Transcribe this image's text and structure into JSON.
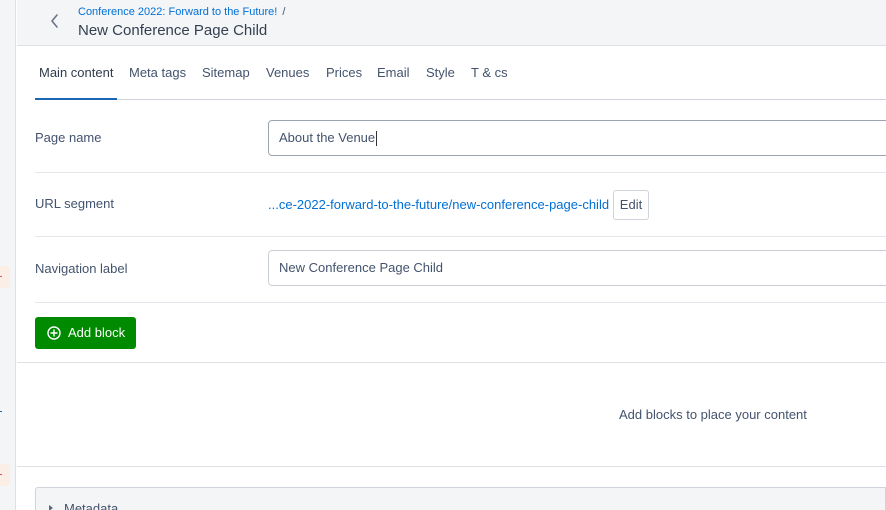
{
  "header": {
    "breadcrumb": "Conference 2022: Forward to the Future!",
    "separator": "/",
    "title": "New Conference Page Child",
    "back_icon": "chevron-left-icon"
  },
  "tabs": [
    {
      "label": "Main content",
      "active": true
    },
    {
      "label": "Meta tags",
      "active": false
    },
    {
      "label": "Sitemap",
      "active": false
    },
    {
      "label": "Venues",
      "active": false
    },
    {
      "label": "Prices",
      "active": false
    },
    {
      "label": "Email",
      "active": false
    },
    {
      "label": "Style",
      "active": false
    },
    {
      "label": "T & cs",
      "active": false
    }
  ],
  "fields": {
    "page_name": {
      "label": "Page name",
      "value": "About the Venue"
    },
    "url_segment": {
      "label": "URL segment",
      "value": "...ce-2022-forward-to-the-future/new-conference-page-child",
      "edit_label": "Edit"
    },
    "navigation_label": {
      "label": "Navigation label",
      "value": "New Conference Page Child"
    }
  },
  "add_block": {
    "label": "Add block",
    "icon": "plus-circle-icon",
    "color": "#008a00"
  },
  "empty_state": "Add blocks to place your content",
  "metadata_panel": {
    "label": "Metadata",
    "icon": "caret-right-icon"
  },
  "colors": {
    "accent": "#1a66b3",
    "link": "#0070d6",
    "success": "#008a00"
  }
}
